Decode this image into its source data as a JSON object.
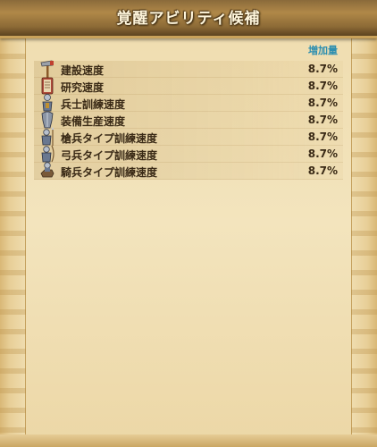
{
  "header": {
    "title": "覚醒アビリティ候補"
  },
  "table": {
    "column_header": "増加量",
    "rows": [
      {
        "label": "建設速度",
        "value": "8.7%",
        "icon": "hammer-icon"
      },
      {
        "label": "研究速度",
        "value": "8.7%",
        "icon": "scroll-book-icon"
      },
      {
        "label": "兵士訓練速度",
        "value": "8.7%",
        "icon": "soldier-icon"
      },
      {
        "label": "装備生産速度",
        "value": "8.7%",
        "icon": "armor-icon"
      },
      {
        "label": "槍兵タイプ訓練速度",
        "value": "8.7%",
        "icon": "spearman-icon"
      },
      {
        "label": "弓兵タイプ訓練速度",
        "value": "8.7%",
        "icon": "archer-icon"
      },
      {
        "label": "騎兵タイプ訓練速度",
        "value": "8.7%",
        "icon": "cavalry-icon"
      }
    ]
  }
}
